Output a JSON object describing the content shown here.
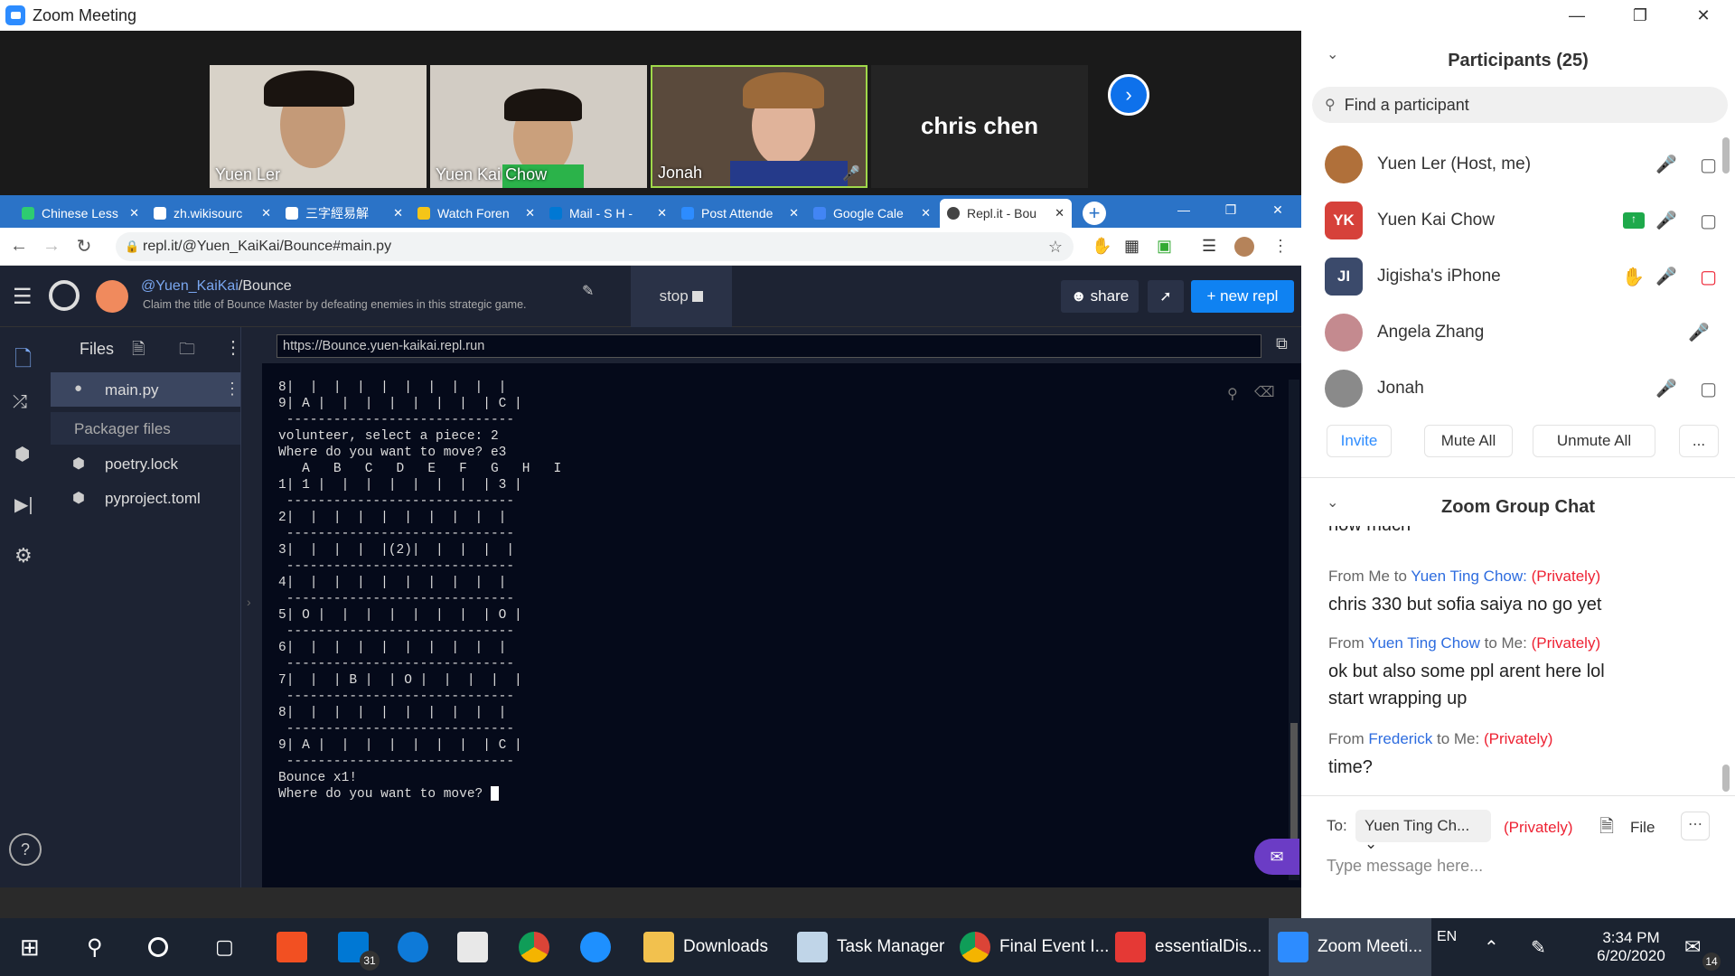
{
  "zoom": {
    "title": "Zoom Meeting"
  },
  "videos": [
    {
      "name": "Yuen Ler"
    },
    {
      "name": "Yuen Kai Chow"
    },
    {
      "name": "Jonah"
    },
    {
      "name": "chris chen"
    }
  ],
  "tabs": [
    {
      "label": "Chinese Less",
      "color": "#2ecc71"
    },
    {
      "label": "zh.wikisourc",
      "color": "#ffffff"
    },
    {
      "label": "三字經易解",
      "color": "#ffffff"
    },
    {
      "label": "Watch Foren",
      "color": "#f5c518"
    },
    {
      "label": "Mail - S H -",
      "color": "#0078d4"
    },
    {
      "label": "Post Attende",
      "color": "#2d8cff"
    },
    {
      "label": "Google Cale",
      "color": "#4285f4"
    },
    {
      "label": "Repl.it - Bou",
      "color": "#444444"
    }
  ],
  "browser": {
    "url": "repl.it/@Yuen_KaiKai/Bounce#main.py"
  },
  "repl": {
    "owner": "@Yuen_KaiKai",
    "slash": "/",
    "name": "Bounce",
    "description": "Claim the title of Bounce Master by defeating enemies in this strategic game.",
    "stop": "stop",
    "share": "share",
    "new": "+ new repl",
    "files_label": "Files",
    "files": [
      "main.py",
      "Packager files",
      "poetry.lock",
      "pyproject.toml"
    ],
    "web_url": "https://Bounce.yuen-kaikai.repl.run"
  },
  "console_lines": [
    "8|  |  |  |  |  |  |  |  |  |",
    "9| A |  |  |  |  |  |  |  | C |",
    " -----------------------------",
    "",
    "volunteer, select a piece: 2",
    "Where do you want to move? e3",
    "",
    "   A   B   C   D   E   F   G   H   I",
    "",
    "1| 1 |  |  |  |  |  |  |  | 3 |",
    " -----------------------------",
    "2|  |  |  |  |  |  |  |  |  |",
    " -----------------------------",
    "3|  |  |  |  |(2)|  |  |  |  |",
    " -----------------------------",
    "4|  |  |  |  |  |  |  |  |  |",
    " -----------------------------",
    "5| O |  |  |  |  |  |  |  | O |",
    " -----------------------------",
    "6|  |  |  |  |  |  |  |  |  |",
    " -----------------------------",
    "7|  |  | B |  | O |  |  |  |  |",
    " -----------------------------",
    "8|  |  |  |  |  |  |  |  |  |",
    " -----------------------------",
    "9| A |  |  |  |  |  |  |  | C |",
    " -----------------------------",
    "",
    "Bounce x1!",
    "Where do you want to move? "
  ],
  "participants": {
    "title": "Participants (25)",
    "search_placeholder": "Find a participant",
    "list": [
      {
        "name": "Yuen Ler (Host, me)",
        "initials": "",
        "color": "#b0703a"
      },
      {
        "name": "Yuen Kai Chow",
        "initials": "YK",
        "color": "#d6413a"
      },
      {
        "name": "Jigisha's iPhone",
        "initials": "JI",
        "color": "#3b4a6b"
      },
      {
        "name": "Angela Zhang",
        "initials": "",
        "color": "#c48a8f"
      },
      {
        "name": "Jonah",
        "initials": "",
        "color": "#8a8a8a"
      }
    ],
    "invite": "Invite",
    "mute_all": "Mute All",
    "unmute_all": "Unmute All",
    "more": "..."
  },
  "chat": {
    "title": "Zoom Group Chat",
    "cut_text": "how much",
    "messages": [
      {
        "from": "From Me to ",
        "who": "Yuen Ting Chow:",
        "priv": "(Privately)",
        "text": "chris 330 but sofia saiya no go yet"
      },
      {
        "from": "From ",
        "who": "Yuen Ting Chow",
        "to": " to Me:",
        "priv": "(Privately)",
        "text": "ok but also some ppl arent here lol start wrapping up"
      },
      {
        "from": "From ",
        "who": "Frederick",
        "to": " to Me:",
        "priv": "(Privately)",
        "text": "time?"
      }
    ],
    "to_label": "To:",
    "to_value": "Yuen Ting Ch...",
    "priv": "(Privately)",
    "file": "File",
    "input_placeholder": "Type message here..."
  },
  "taskbar": {
    "items": [
      "Downloads",
      "Task Manager",
      "Final Event I...",
      "essentialDis...",
      "Zoom Meeti..."
    ],
    "lang": "EN",
    "time": "3:34 PM",
    "date": "6/20/2020",
    "mail_badge": "31",
    "notif_badge": "14"
  }
}
